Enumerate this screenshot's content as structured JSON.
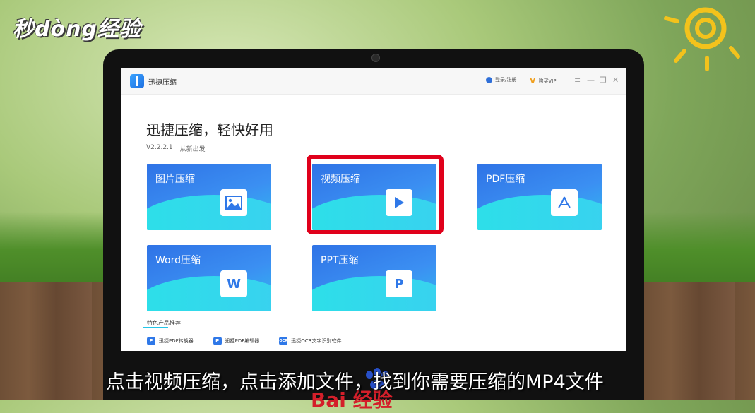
{
  "brand_logo": "秒dòng经验",
  "app": {
    "name": "迅捷压缩",
    "login": "登录/注册",
    "vip": "购买VIP",
    "headline": "迅捷压缩，轻快好用",
    "version": "V2.2.2.1",
    "version_tag": "从新出发"
  },
  "window_controls": {
    "menu": "≡",
    "minimize": "—",
    "restore": "❐",
    "close": "✕"
  },
  "cards": [
    {
      "label": "图片压缩",
      "icon": "image-icon"
    },
    {
      "label": "视频压缩",
      "icon": "play-icon"
    },
    {
      "label": "PDF压缩",
      "icon": "pdf-icon"
    },
    {
      "label": "Word压缩",
      "icon": "word-icon",
      "glyph": "W"
    },
    {
      "label": "PPT压缩",
      "icon": "ppt-icon",
      "glyph": "P"
    }
  ],
  "featured": {
    "title": "特色产品推荐",
    "items": [
      {
        "label": "迅捷PDF转换器",
        "glyph": "P"
      },
      {
        "label": "迅捷PDF编辑器",
        "glyph": "P"
      },
      {
        "label": "迅捷OCR文字识别软件",
        "glyph": "OCR"
      }
    ]
  },
  "subtitle": "点击视频压缩，点击添加文件，找到你需要压缩的MP4文件",
  "watermark": "Bai 经验",
  "colors": {
    "accent": "#2f73e6",
    "highlight": "#e0001b",
    "wave": "#2ce0e8"
  }
}
